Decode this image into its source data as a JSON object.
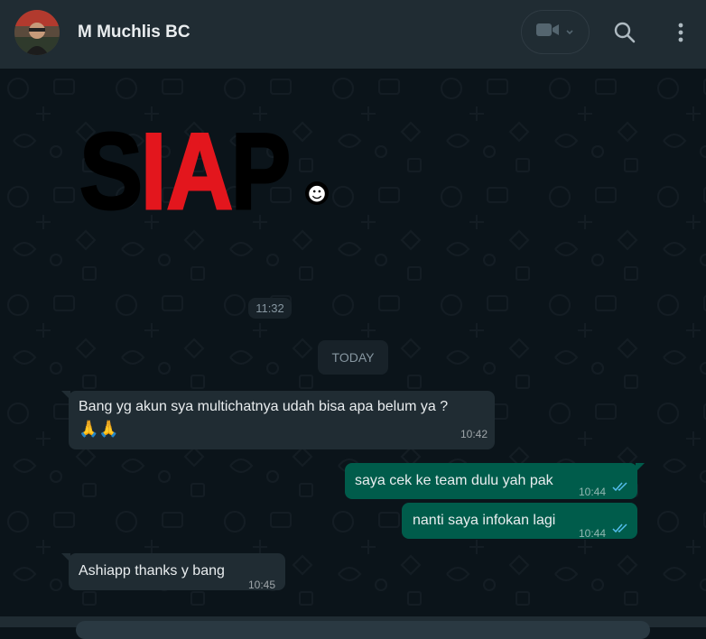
{
  "header": {
    "contact_name": "M Muchlis BC",
    "video_call_icon": "video-camera-icon",
    "dropdown_icon": "chevron-down-icon",
    "search_icon": "search-icon",
    "menu_icon": "more-vertical-icon"
  },
  "sticker": {
    "text_s": "S",
    "text_ia": "IA",
    "text_p": "P",
    "emoji": "☻",
    "time": "11:32"
  },
  "date_divider": "TODAY",
  "messages": [
    {
      "direction": "incoming",
      "line1": "Bang yg akun sya multichatnya udah bisa apa belum ya ?",
      "line2": "🙏🙏",
      "time": "10:42"
    },
    {
      "direction": "outgoing",
      "text": "saya cek ke team dulu yah pak",
      "time": "10:44",
      "status": "read"
    },
    {
      "direction": "outgoing",
      "text": "nanti saya infokan lagi",
      "time": "10:44",
      "status": "read"
    },
    {
      "direction": "incoming",
      "text": "Ashiapp thanks y bang",
      "time": "10:45"
    }
  ],
  "colors": {
    "header_bg": "#202c33",
    "chat_bg": "#0b141a",
    "incoming_bubble": "#202c33",
    "outgoing_bubble": "#005c4b",
    "read_ticks": "#53bdeb",
    "sticker_red": "#e3161d"
  }
}
